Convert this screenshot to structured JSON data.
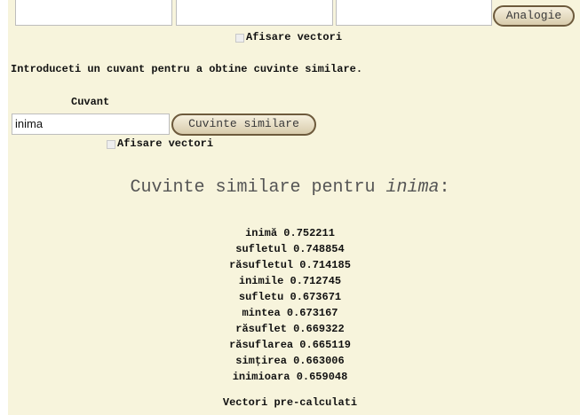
{
  "analogy": {
    "button_label": "Analogie",
    "show_vectors_label": "Afisare vectori"
  },
  "similar": {
    "instruction": "Introduceti un cuvant pentru a obtine cuvinte similare.",
    "word_label": "Cuvant",
    "word_value": "inima",
    "button_label": "Cuvinte similare",
    "show_vectors_label": "Afisare vectori"
  },
  "results": {
    "title_prefix": "Cuvinte similare pentru ",
    "title_word": "inima",
    "title_suffix": ":",
    "items": [
      "inimă 0.752211",
      "sufletul 0.748854",
      "răsufletul 0.714185",
      "inimile 0.712745",
      "sufletu 0.673671",
      "mintea 0.673167",
      "răsuflet 0.669322",
      "răsuflarea 0.665119",
      "simțirea 0.663006",
      "inimioara 0.659048"
    ]
  },
  "footer": {
    "precalc_label": "Vectori pre-calculati"
  }
}
